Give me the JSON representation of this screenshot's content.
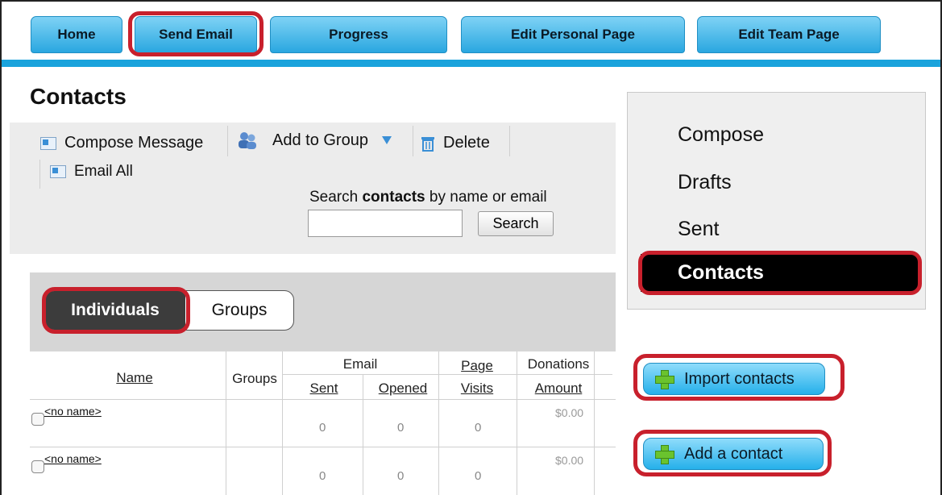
{
  "nav": {
    "tabs": [
      {
        "label": "Home"
      },
      {
        "label": "Send Email"
      },
      {
        "label": "Progress"
      },
      {
        "label": "Edit Personal Page"
      },
      {
        "label": "Edit Team Page"
      }
    ]
  },
  "page": {
    "title": "Contacts"
  },
  "toolbar": {
    "compose": "Compose Message",
    "add_group": "Add to Group",
    "delete": "Delete",
    "email_all": "Email All",
    "search_label_prefix": "Search ",
    "search_label_bold": "contacts",
    "search_label_suffix": " by name or email",
    "search_value": "",
    "search_button": "Search"
  },
  "contacts": {
    "tabs": {
      "individuals": "Individuals",
      "groups": "Groups"
    },
    "headers": {
      "name": "Name",
      "groups": "Groups",
      "email": "Email",
      "sent": "Sent",
      "opened": "Opened",
      "page": "Page",
      "visits": "Visits",
      "donations": "Donations",
      "amount": "Amount"
    },
    "rows": [
      {
        "name": "<no name>",
        "sent": "0",
        "opened": "0",
        "visits": "0",
        "amount": "$0.00"
      },
      {
        "name": "<no name>",
        "sent": "0",
        "opened": "0",
        "visits": "0",
        "amount": "$0.00"
      }
    ]
  },
  "side_menu": {
    "items": [
      "Compose",
      "Drafts",
      "Sent"
    ],
    "active": "Contacts"
  },
  "actions": {
    "import": "Import contacts",
    "add": "Add a contact"
  },
  "colors": {
    "nav_blue": "#29a7e0",
    "highlight_red": "#c8202c",
    "active_menu": "#000000",
    "plus_green": "#6ac32e"
  }
}
